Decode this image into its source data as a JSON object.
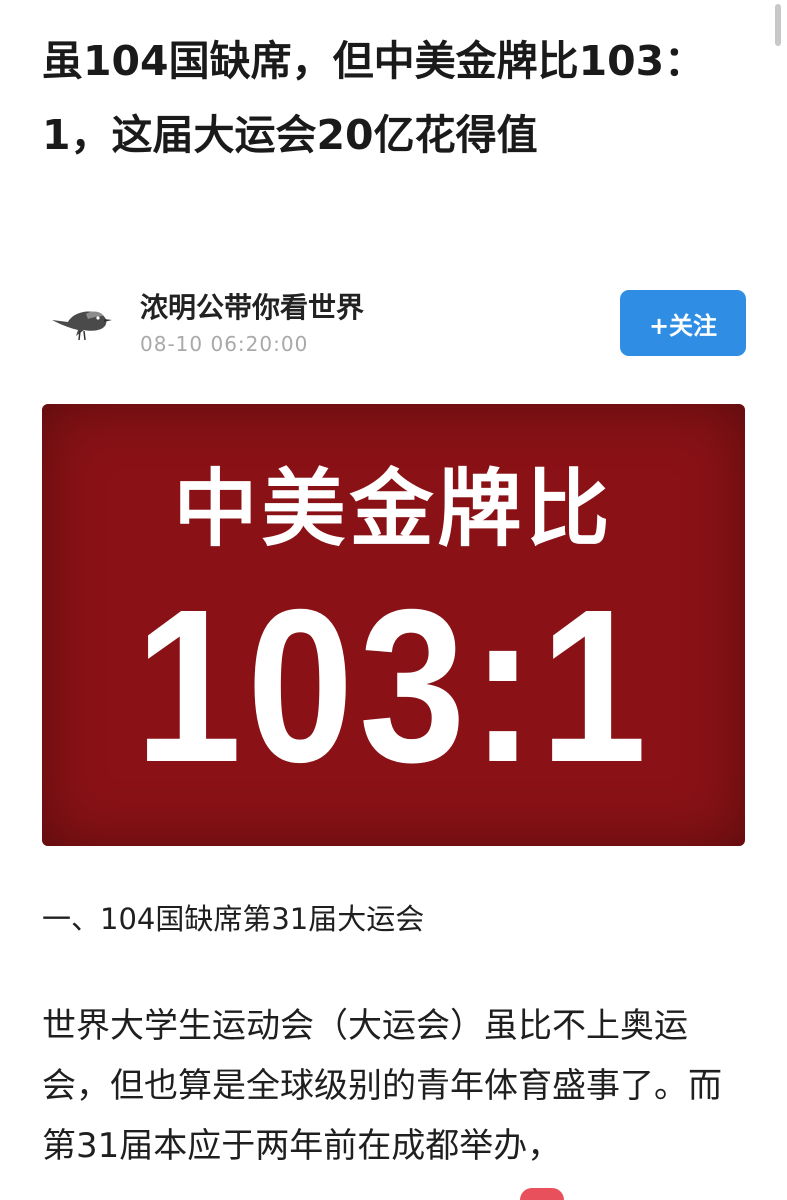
{
  "article": {
    "title": "虽104国缺席，但中美金牌比103：1，这届大运会20亿花得值",
    "author": {
      "name": "浓明公带你看世界",
      "time": "08-10 06:20:00",
      "avatar_icon": "bird-icon"
    },
    "follow_label": "+关注",
    "hero": {
      "heading": "中美金牌比",
      "score": "103:1",
      "background_color": "#8a1216"
    },
    "section_heading": "一、104国缺席第31届大运会",
    "body_text": "世界大学生运动会（大运会）虽比不上奥运会，但也算是全球级别的青年体育盛事了。而第31届本应于两年前在成都举办，"
  },
  "colors": {
    "follow_button": "#2f8de4",
    "hero_red": "#8a1216",
    "meta_gray": "#a9a9a9"
  }
}
